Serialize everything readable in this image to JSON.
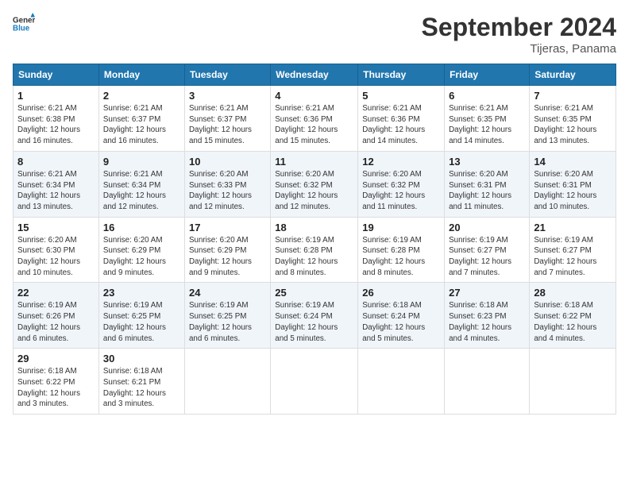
{
  "logo": {
    "line1": "General",
    "line2": "Blue"
  },
  "title": "September 2024",
  "subtitle": "Tijeras, Panama",
  "days_header": [
    "Sunday",
    "Monday",
    "Tuesday",
    "Wednesday",
    "Thursday",
    "Friday",
    "Saturday"
  ],
  "weeks": [
    [
      {
        "num": "1",
        "rise": "6:21 AM",
        "set": "6:38 PM",
        "daylight": "12 hours and 16 minutes."
      },
      {
        "num": "2",
        "rise": "6:21 AM",
        "set": "6:37 PM",
        "daylight": "12 hours and 16 minutes."
      },
      {
        "num": "3",
        "rise": "6:21 AM",
        "set": "6:37 PM",
        "daylight": "12 hours and 15 minutes."
      },
      {
        "num": "4",
        "rise": "6:21 AM",
        "set": "6:36 PM",
        "daylight": "12 hours and 15 minutes."
      },
      {
        "num": "5",
        "rise": "6:21 AM",
        "set": "6:36 PM",
        "daylight": "12 hours and 14 minutes."
      },
      {
        "num": "6",
        "rise": "6:21 AM",
        "set": "6:35 PM",
        "daylight": "12 hours and 14 minutes."
      },
      {
        "num": "7",
        "rise": "6:21 AM",
        "set": "6:35 PM",
        "daylight": "12 hours and 13 minutes."
      }
    ],
    [
      {
        "num": "8",
        "rise": "6:21 AM",
        "set": "6:34 PM",
        "daylight": "12 hours and 13 minutes."
      },
      {
        "num": "9",
        "rise": "6:21 AM",
        "set": "6:34 PM",
        "daylight": "12 hours and 12 minutes."
      },
      {
        "num": "10",
        "rise": "6:20 AM",
        "set": "6:33 PM",
        "daylight": "12 hours and 12 minutes."
      },
      {
        "num": "11",
        "rise": "6:20 AM",
        "set": "6:32 PM",
        "daylight": "12 hours and 12 minutes."
      },
      {
        "num": "12",
        "rise": "6:20 AM",
        "set": "6:32 PM",
        "daylight": "12 hours and 11 minutes."
      },
      {
        "num": "13",
        "rise": "6:20 AM",
        "set": "6:31 PM",
        "daylight": "12 hours and 11 minutes."
      },
      {
        "num": "14",
        "rise": "6:20 AM",
        "set": "6:31 PM",
        "daylight": "12 hours and 10 minutes."
      }
    ],
    [
      {
        "num": "15",
        "rise": "6:20 AM",
        "set": "6:30 PM",
        "daylight": "12 hours and 10 minutes."
      },
      {
        "num": "16",
        "rise": "6:20 AM",
        "set": "6:29 PM",
        "daylight": "12 hours and 9 minutes."
      },
      {
        "num": "17",
        "rise": "6:20 AM",
        "set": "6:29 PM",
        "daylight": "12 hours and 9 minutes."
      },
      {
        "num": "18",
        "rise": "6:19 AM",
        "set": "6:28 PM",
        "daylight": "12 hours and 8 minutes."
      },
      {
        "num": "19",
        "rise": "6:19 AM",
        "set": "6:28 PM",
        "daylight": "12 hours and 8 minutes."
      },
      {
        "num": "20",
        "rise": "6:19 AM",
        "set": "6:27 PM",
        "daylight": "12 hours and 7 minutes."
      },
      {
        "num": "21",
        "rise": "6:19 AM",
        "set": "6:27 PM",
        "daylight": "12 hours and 7 minutes."
      }
    ],
    [
      {
        "num": "22",
        "rise": "6:19 AM",
        "set": "6:26 PM",
        "daylight": "12 hours and 6 minutes."
      },
      {
        "num": "23",
        "rise": "6:19 AM",
        "set": "6:25 PM",
        "daylight": "12 hours and 6 minutes."
      },
      {
        "num": "24",
        "rise": "6:19 AM",
        "set": "6:25 PM",
        "daylight": "12 hours and 6 minutes."
      },
      {
        "num": "25",
        "rise": "6:19 AM",
        "set": "6:24 PM",
        "daylight": "12 hours and 5 minutes."
      },
      {
        "num": "26",
        "rise": "6:18 AM",
        "set": "6:24 PM",
        "daylight": "12 hours and 5 minutes."
      },
      {
        "num": "27",
        "rise": "6:18 AM",
        "set": "6:23 PM",
        "daylight": "12 hours and 4 minutes."
      },
      {
        "num": "28",
        "rise": "6:18 AM",
        "set": "6:22 PM",
        "daylight": "12 hours and 4 minutes."
      }
    ],
    [
      {
        "num": "29",
        "rise": "6:18 AM",
        "set": "6:22 PM",
        "daylight": "12 hours and 3 minutes."
      },
      {
        "num": "30",
        "rise": "6:18 AM",
        "set": "6:21 PM",
        "daylight": "12 hours and 3 minutes."
      },
      null,
      null,
      null,
      null,
      null
    ]
  ],
  "labels": {
    "sunrise": "Sunrise:",
    "sunset": "Sunset:",
    "daylight": "Daylight:"
  }
}
